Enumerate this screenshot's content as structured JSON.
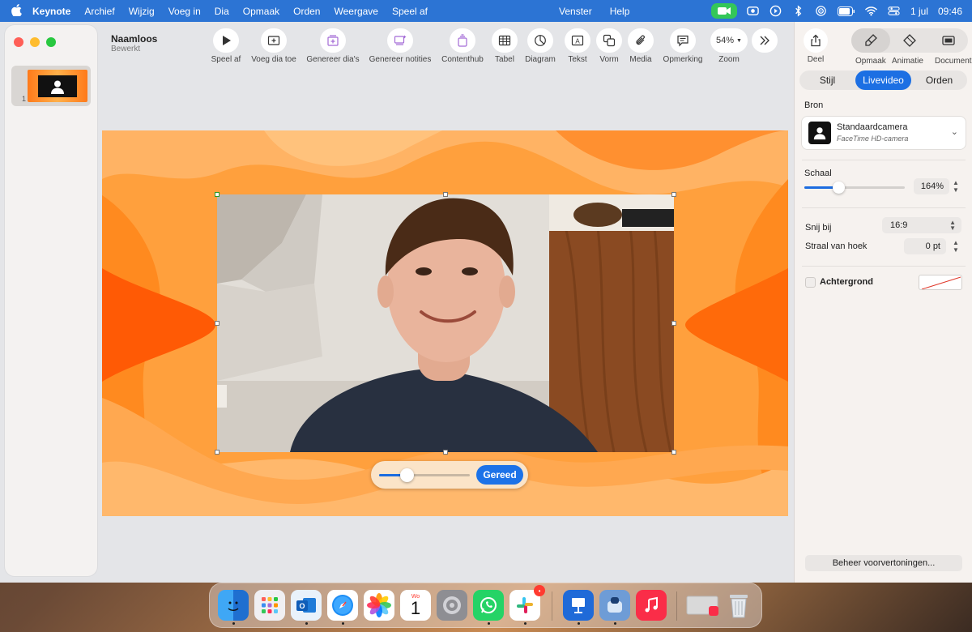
{
  "menubar": {
    "apple_icon": "apple-icon",
    "items": [
      "Keynote",
      "Archief",
      "Wijzig",
      "Voeg in",
      "Dia",
      "Opmaak",
      "Orden",
      "Weergave",
      "Speel af"
    ],
    "window_items": [
      "Venster",
      "Help"
    ],
    "date": "1 jul",
    "time": "09:46"
  },
  "document": {
    "title": "Naamloos",
    "subtitle": "Bewerkt"
  },
  "toolbar": {
    "play": "Speel af",
    "add_slide": "Voeg dia toe",
    "generate_slides": "Genereer dia's",
    "generate_notes": "Genereer notities",
    "content_hub": "Contenthub",
    "table": "Tabel",
    "chart": "Diagram",
    "text": "Tekst",
    "shape": "Vorm",
    "media": "Media",
    "comment": "Opmerking",
    "zoom_value": "54%",
    "zoom_label": "Zoom"
  },
  "navigator": {
    "slide_number": "1"
  },
  "canvas": {
    "scale_done": "Gereed",
    "scale_fraction": 0.3
  },
  "inspector": {
    "share": "Deel",
    "segments": [
      "Opmaak",
      "Animatie",
      "Document"
    ],
    "tabs": [
      "Stijl",
      "Livevideo",
      "Orden"
    ],
    "active_tab": "Livevideo",
    "source_label": "Bron",
    "camera_name": "Standaardcamera",
    "camera_sub": "FaceTime HD-camera",
    "scale_label": "Schaal",
    "scale_value": "164%",
    "scale_fraction": 0.34,
    "crop_label": "Snij bij",
    "crop_value": "16:9",
    "corner_label": "Straal van hoek",
    "corner_value": "0 pt",
    "background_label": "Achtergrond",
    "manage_previews": "Beheer voorvertoningen..."
  },
  "dock": {
    "apps": [
      "finder",
      "launchpad",
      "outlook",
      "safari",
      "photos",
      "calendar",
      "system-settings",
      "whatsapp",
      "slack",
      "keynote",
      "app-store-like",
      "music",
      "recent-window",
      "trash"
    ],
    "calendar_month": "Wo",
    "calendar_day": "1"
  },
  "colors": {
    "accent": "#1c6fe3",
    "menubar": "#2c74d4",
    "slide_orange": "#ff9a33"
  }
}
